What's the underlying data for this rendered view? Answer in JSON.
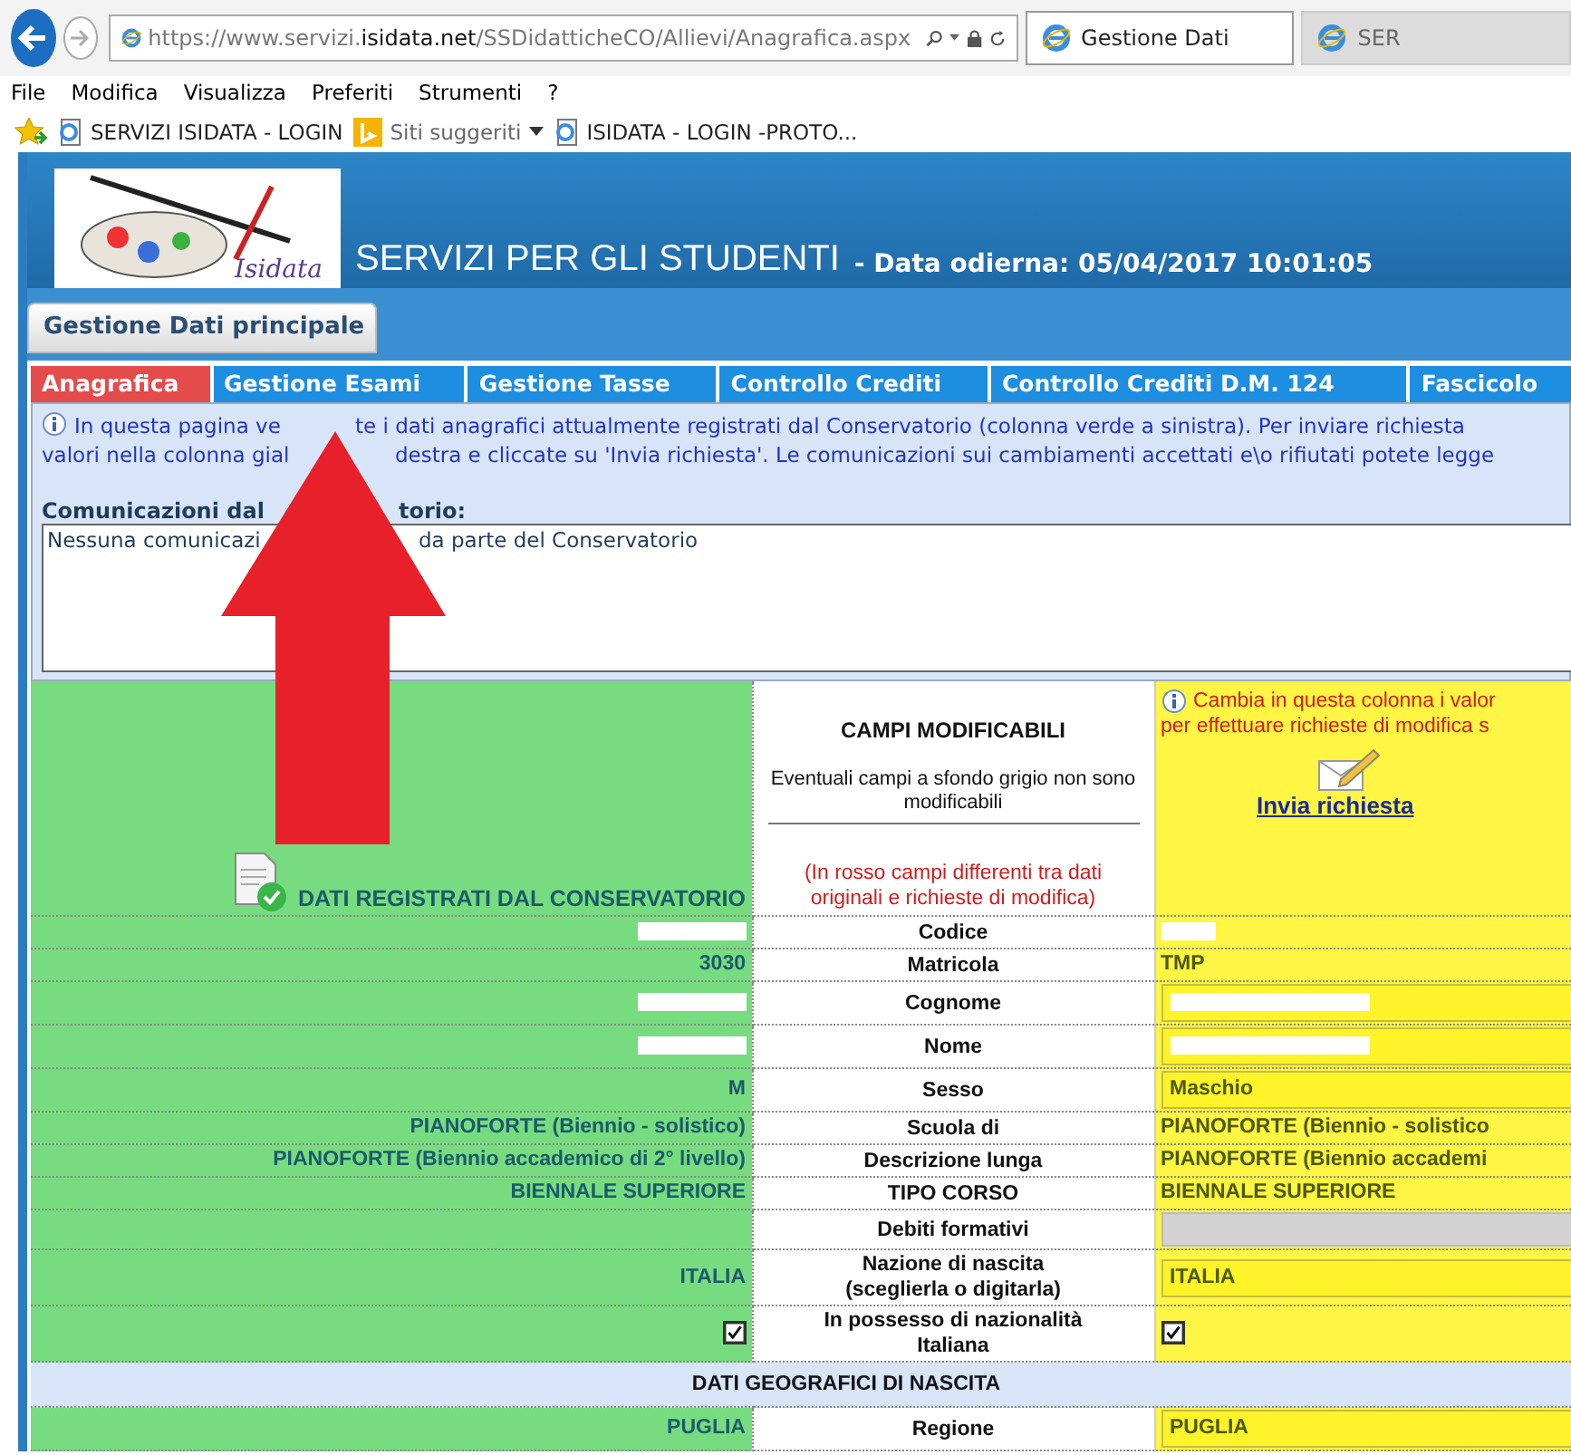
{
  "browser": {
    "url_prefix": "https://www.servizi.",
    "url_domain": "isidata.net",
    "url_path": "/SSDidatticheCO/Allievi/Anagrafica.aspx",
    "tabs": [
      {
        "label": "Gestione Dati",
        "selected": true
      },
      {
        "label": "SER",
        "selected": false
      }
    ],
    "menu": [
      "File",
      "Modifica",
      "Visualizza",
      "Preferiti",
      "Strumenti",
      "?"
    ],
    "favorites": [
      {
        "kind": "page",
        "label": "SERVIZI ISIDATA - LOGIN"
      },
      {
        "kind": "suggested",
        "label": "Siti suggeriti"
      },
      {
        "kind": "page",
        "label": "ISIDATA - LOGIN -PROTO..."
      }
    ]
  },
  "header": {
    "logo_text": "Isidata",
    "title": "SERVIZI PER GLI STUDENTI",
    "date": "- Data odierna: 05/04/2017 10:01:05"
  },
  "section_tab": "Gestione Dati principale",
  "nav": [
    {
      "label": "Anagrafica",
      "selected": true
    },
    {
      "label": "Gestione Esami",
      "selected": false
    },
    {
      "label": "Gestione Tasse",
      "selected": false
    },
    {
      "label": "Controllo Crediti",
      "selected": false
    },
    {
      "label": "Controllo Crediti D.M. 124",
      "selected": false
    },
    {
      "label": "Fascicolo",
      "selected": false
    }
  ],
  "info": {
    "lines": [
      [
        "In questa pagina ve",
        "te i dati anagrafici attualmente registrati dal Conservatorio (colonna verde a sinistra). Per inviare richiesta"
      ],
      [
        "valori nella colonna gial",
        "destra e cliccate su 'Invia richiesta'. Le comunicazioni sui cambiamenti accettati e\\o rifiutati potete legge"
      ]
    ],
    "comm_label": [
      "Comunicazioni dal",
      "torio:"
    ],
    "comm_text": [
      "Nessuna comunicazi",
      "da parte del Conservatorio"
    ]
  },
  "table": {
    "left_title": "DATI REGISTRATI DAL CONSERVATORIO",
    "mid_title": "CAMPI MODIFICABILI",
    "mid_note": "Eventuali campi a sfondo grigio non sono modificabili",
    "mid_red": "(In rosso campi differenti tra dati originali e richieste di modifica)",
    "right_lines": [
      "Cambia in questa colonna i valor",
      "per effettuare richieste di modifica s"
    ],
    "right_link": "Invia richiesta",
    "rows": [
      {
        "kind": "field",
        "label": "Codice",
        "left": {
          "kind": "redacted"
        },
        "right": {
          "kind": "redacted"
        }
      },
      {
        "kind": "field",
        "label": "Matricola",
        "left": {
          "kind": "text",
          "value": "3030"
        },
        "right": {
          "kind": "text",
          "value": "TMP"
        }
      },
      {
        "kind": "field",
        "label": "Cognome",
        "left": {
          "kind": "redacted"
        },
        "right": {
          "kind": "redacted_input"
        }
      },
      {
        "kind": "field",
        "label": "Nome",
        "left": {
          "kind": "redacted"
        },
        "right": {
          "kind": "redacted_input"
        }
      },
      {
        "kind": "field",
        "label": "Sesso",
        "left": {
          "kind": "text",
          "value": "M"
        },
        "right": {
          "kind": "input",
          "value": "Maschio"
        }
      },
      {
        "kind": "field",
        "label": "Scuola di",
        "left": {
          "kind": "text",
          "value": "PIANOFORTE (Biennio - solistico)"
        },
        "right": {
          "kind": "text",
          "value": "PIANOFORTE (Biennio - solistico"
        }
      },
      {
        "kind": "field",
        "label": "Descrizione lunga",
        "left": {
          "kind": "text",
          "value": "PIANOFORTE (Biennio accademico di 2° livello)"
        },
        "right": {
          "kind": "text",
          "value": "PIANOFORTE (Biennio accademi"
        }
      },
      {
        "kind": "field",
        "label": "TIPO CORSO",
        "left": {
          "kind": "text",
          "value": "BIENNALE SUPERIORE"
        },
        "right": {
          "kind": "text",
          "value": "BIENNALE SUPERIORE"
        }
      },
      {
        "kind": "field",
        "label": "Debiti formativi",
        "left": {
          "kind": "empty"
        },
        "right": {
          "kind": "disabled"
        }
      },
      {
        "kind": "field",
        "label": "Nazione di nascita\n(sceglierla o digitarla)",
        "left": {
          "kind": "text",
          "value": "ITALIA"
        },
        "right": {
          "kind": "input",
          "value": "ITALIA"
        }
      },
      {
        "kind": "field",
        "label": "In possesso di nazionalità\nItaliana",
        "left": {
          "kind": "checkbox",
          "checked": true
        },
        "right": {
          "kind": "checkbox",
          "checked": true
        }
      },
      {
        "kind": "section",
        "label": "DATI GEOGRAFICI DI NASCITA"
      },
      {
        "kind": "field",
        "label": "Regione",
        "left": {
          "kind": "text",
          "value": "PUGLIA"
        },
        "right": {
          "kind": "input",
          "value": "PUGLIA"
        }
      }
    ]
  }
}
